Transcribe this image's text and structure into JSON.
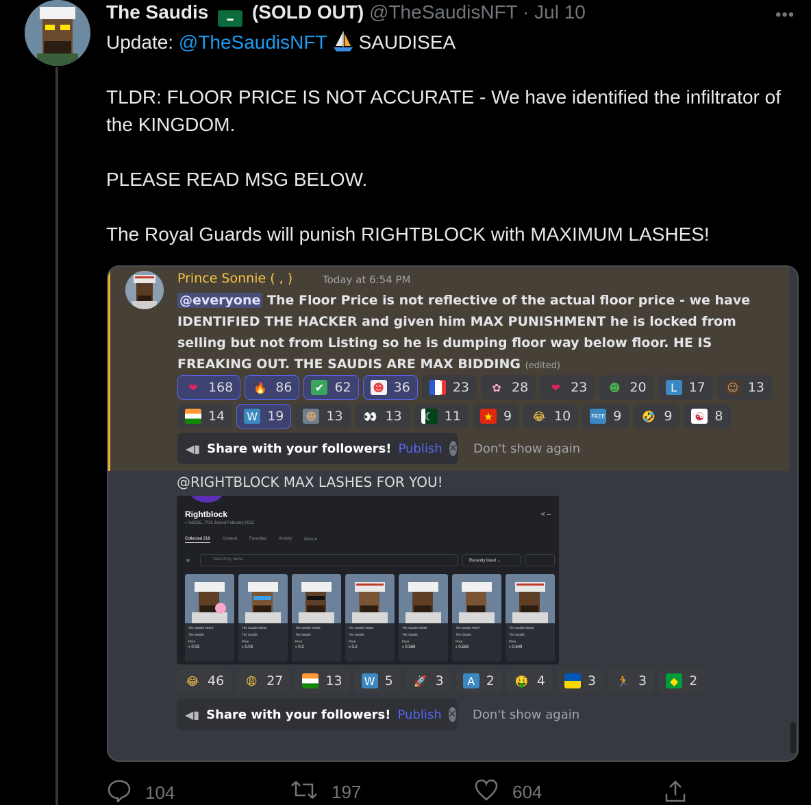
{
  "tweet": {
    "author_name": "The Saudis",
    "author_flag": "SA",
    "author_suffix": "(SOLD OUT)",
    "handle": "@TheSaudisNFT",
    "dot": "·",
    "date": "Jul 10",
    "line1_prefix": "Update: ",
    "line1_mention": "@TheSaudisNFT",
    "line1_suffix": "SAUDISEA",
    "para2": "TLDR: FLOOR PRICE IS NOT ACCURATE - We have identified the infiltrator of the KINGDOM.",
    "para3": "PLEASE READ MSG BELOW.",
    "para4": "The Royal Guards will punish RIGHTBLOCK with MAXIMUM LASHES!",
    "actions": {
      "reply_count": "104",
      "retweet_count": "197",
      "like_count": "604"
    }
  },
  "discord": {
    "author": "Prince Sonnie ( , )",
    "time": "Today at 6:54 PM",
    "everyone": "@everyone",
    "body": " The Floor Price is not reflective of the actual floor price - we have IDENTIFIED THE HACKER and given him MAX PUNISHMENT he is locked from selling but not from Listing so he is dumping floor way below floor. HE IS FREAKING OUT. THE SAUDIS ARE MAX BIDDING",
    "edited": "(edited)",
    "reactions_row1": [
      {
        "icon": "heart",
        "count": "168",
        "me": true
      },
      {
        "icon": "fire",
        "count": "86",
        "me": true
      },
      {
        "icon": "check",
        "count": "62",
        "me": true
      },
      {
        "icon": "clown",
        "count": "36",
        "me": true
      },
      {
        "icon": "flag-fr",
        "count": "23",
        "me": false
      },
      {
        "icon": "brain",
        "count": "28",
        "me": false
      },
      {
        "icon": "heart",
        "count": "23",
        "me": false
      },
      {
        "icon": "pepe",
        "count": "20",
        "me": false
      },
      {
        "icon": "letter-l",
        "count": "17",
        "me": false
      },
      {
        "icon": "face",
        "count": "13",
        "me": false
      }
    ],
    "reactions_row2": [
      {
        "icon": "flag-in",
        "count": "14",
        "me": false
      },
      {
        "icon": "letter-w",
        "count": "19",
        "me": true
      },
      {
        "icon": "pixel-saudi",
        "count": "13",
        "me": false
      },
      {
        "icon": "eyes",
        "count": "13",
        "me": false
      },
      {
        "icon": "flag-pk",
        "count": "11",
        "me": false
      },
      {
        "icon": "flag-cn",
        "count": "9",
        "me": false
      },
      {
        "icon": "laugh",
        "count": "10",
        "me": false
      },
      {
        "icon": "free",
        "count": "9",
        "me": false
      },
      {
        "icon": "rofl",
        "count": "9",
        "me": false
      },
      {
        "icon": "flag-kr",
        "count": "8",
        "me": false
      }
    ],
    "share_text": "Share with your followers!",
    "publish": "Publish",
    "dont_show": "Don't show again",
    "msg2_text": "@RIGHTBLOCK MAX LASHES FOR YOU!",
    "reactions_row3": [
      {
        "icon": "laugh",
        "count": "46"
      },
      {
        "icon": "cry-laugh",
        "count": "27"
      },
      {
        "icon": "flag-in",
        "count": "13"
      },
      {
        "icon": "letter-w",
        "count": "5"
      },
      {
        "icon": "rocket",
        "count": "3"
      },
      {
        "icon": "letter-a",
        "count": "2"
      },
      {
        "icon": "money-face",
        "count": "4"
      },
      {
        "icon": "flag-ua",
        "count": "3"
      },
      {
        "icon": "running",
        "count": "3"
      },
      {
        "icon": "flag-br",
        "count": "2"
      }
    ],
    "share_text2": "Share with your followers!",
    "publish2": "Publish",
    "dont_show2": "Don't show again"
  },
  "screenshot": {
    "title": "Rightblock",
    "address": "⬨ 0x8026...7f19   Joined February 2022",
    "share_icon": "<  –",
    "tabs": [
      "Collected 218",
      "Created",
      "Favorited",
      "Activity",
      "More ▾"
    ],
    "search_placeholder": "Search by name",
    "sort": "Recently listed",
    "nfts": [
      {
        "name": "The Saudis #5373",
        "collection": "The Saudis",
        "price_label": "Price",
        "price": "⬨ 0.03"
      },
      {
        "name": "The Saudis #5264",
        "collection": "The Saudis",
        "price_label": "Price",
        "price": "⬨ 0.03"
      },
      {
        "name": "The Saudis #5350",
        "collection": "The Saudis",
        "price_label": "Price",
        "price": "⬨ 0.2"
      },
      {
        "name": "The Saudis #5381",
        "collection": "The Saudis",
        "price_label": "Price",
        "price": "⬨ 0.2"
      },
      {
        "name": "The Saudis #5385",
        "collection": "The Saudis",
        "price_label": "Price",
        "price": "⬨ 0.569"
      },
      {
        "name": "The Saudis #5377",
        "collection": "The Saudis",
        "price_label": "Price",
        "price": "⬨ 0.569"
      },
      {
        "name": "The Saudis #5363",
        "collection": "The Saudis",
        "price_label": "Price",
        "price": "⬨ 0.649"
      }
    ]
  }
}
